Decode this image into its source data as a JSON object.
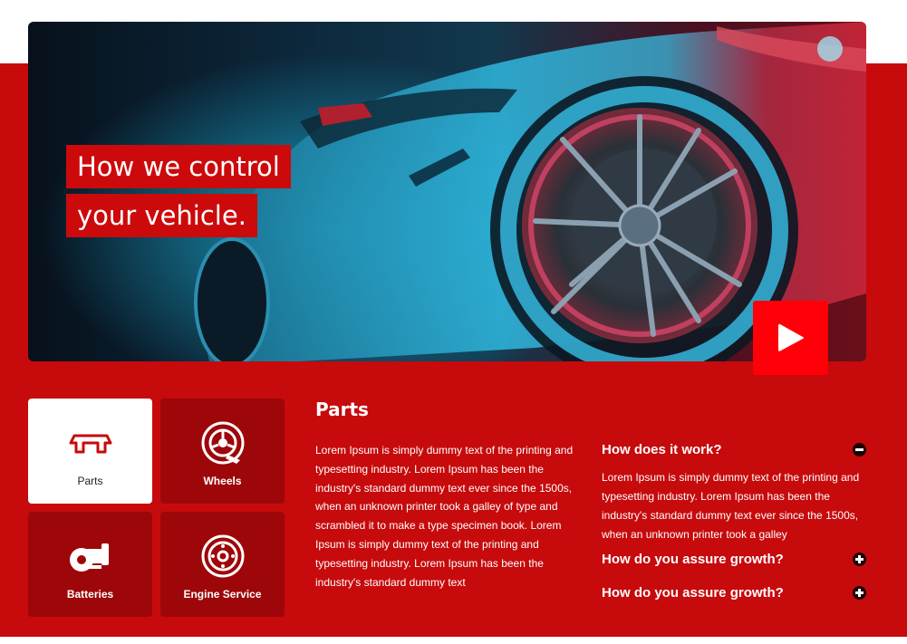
{
  "hero": {
    "title_line1": "How we control",
    "title_line2": "your vehicle."
  },
  "services": [
    {
      "label": "Parts",
      "icon": "car-part-icon",
      "active": true
    },
    {
      "label": "Wheels",
      "icon": "wheel-icon",
      "active": false
    },
    {
      "label": "Batteries",
      "icon": "battery-icon",
      "active": false
    },
    {
      "label": "Engine Service",
      "icon": "brake-disc-icon",
      "active": false
    }
  ],
  "section": {
    "title": "Parts",
    "body": "Lorem Ipsum is simply dummy text of the printing and typesetting industry. Lorem Ipsum has been the industry's standard dummy text ever since the 1500s, when an unknown printer took a galley of type and scrambled it to make a type specimen book. Lorem Ipsum is simply dummy text of the printing and typesetting industry. Lorem Ipsum has been the industry's standard dummy text"
  },
  "faq": [
    {
      "question": "How does it work?",
      "answer": "Lorem Ipsum is simply dummy text of the printing and typesetting industry. Lorem Ipsum has been the industry's standard dummy text ever since the 1500s, when an unknown printer took a galley",
      "expanded": true
    },
    {
      "question": "How do you assure growth?",
      "expanded": false
    },
    {
      "question": "How do you assure growth?",
      "expanded": false
    }
  ],
  "colors": {
    "brand_red": "#c70a0c",
    "tile_red": "#9e0709",
    "play_red": "#ff0008"
  }
}
